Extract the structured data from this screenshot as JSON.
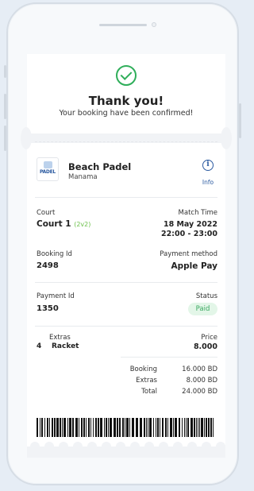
{
  "header": {
    "title": "Thank you!",
    "subtitle": "Your booking have been confirmed!"
  },
  "venue": {
    "logo_text": "PADEL",
    "name": "Beach Padel",
    "city": "Manama",
    "info_label": "Info"
  },
  "booking": {
    "court_label": "Court",
    "court_value": "Court 1",
    "court_format": "(2v2)",
    "match_time_label": "Match Time",
    "match_date": "18 May 2022",
    "match_time": "22:00 - 23:00",
    "booking_id_label": "Booking Id",
    "booking_id": "2498",
    "payment_method_label": "Payment method",
    "payment_method": "Apple Pay",
    "payment_id_label": "Payment Id",
    "payment_id": "1350",
    "status_label": "Status",
    "status": "Paid"
  },
  "extras": {
    "extras_label": "Extras",
    "price_label": "Price",
    "qty": "4",
    "item": "Racket",
    "price": "8.000"
  },
  "summary": {
    "booking_label": "Booking",
    "booking_value": "16.000 BD",
    "extras_label": "Extras",
    "extras_value": "8.000 BD",
    "total_label": "Total",
    "total_value": "24.000 BD"
  },
  "colors": {
    "accent": "#2b5aa0",
    "success": "#2fae5a",
    "court_format": "#6cc04a"
  }
}
